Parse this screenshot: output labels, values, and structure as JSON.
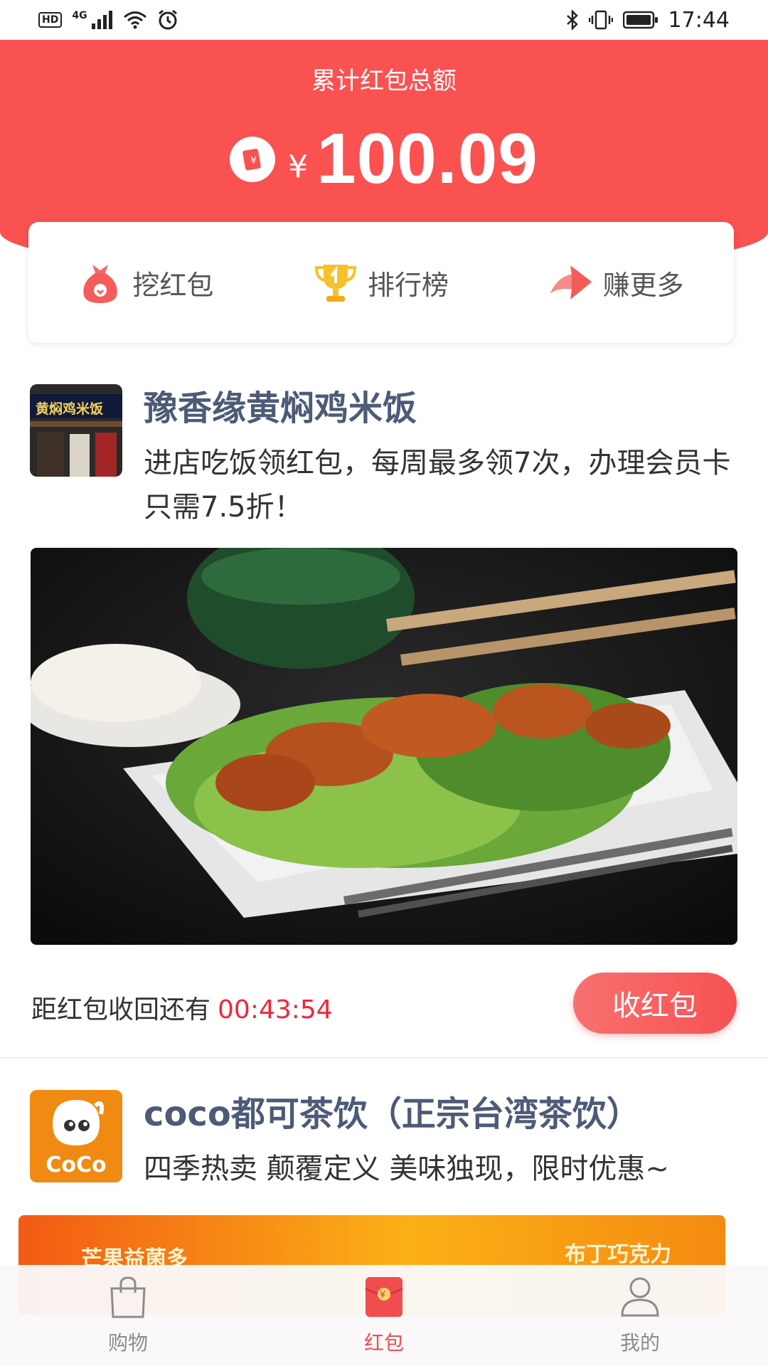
{
  "status_bar": {
    "time": "17:44",
    "network": "4G",
    "hd": "HD"
  },
  "header": {
    "label": "累计红包总额",
    "currency": "¥",
    "amount": "100.09"
  },
  "actions": [
    {
      "label": "挖红包",
      "icon": "money-bag-icon"
    },
    {
      "label": "排行榜",
      "icon": "trophy-icon"
    },
    {
      "label": "赚更多",
      "icon": "arrow-icon"
    }
  ],
  "merchants": [
    {
      "name": "豫香缘黄焖鸡米饭",
      "logo_text": "黄焖鸡米饭",
      "description": "进店吃饭领红包，每周最多领7次，办理会员卡只需7.5折！",
      "countdown_label": "距红包收回还有",
      "countdown_time": "00:43:54",
      "button": "收红包"
    },
    {
      "name": "coco都可茶饮（正宗台湾茶饮）",
      "logo_text": "CoCo",
      "description": "四季热卖 颠覆定义 美味独现，限时优惠~",
      "banner_left": "芒果益菌多",
      "banner_right": "布丁巧克力"
    }
  ],
  "tabs": [
    {
      "label": "购物",
      "icon": "shopping-bag-icon",
      "active": false
    },
    {
      "label": "红包",
      "icon": "red-envelope-icon",
      "active": true
    },
    {
      "label": "我的",
      "icon": "user-icon",
      "active": false
    }
  ],
  "colors": {
    "accent": "#fa5151",
    "name_color": "#4d5a78",
    "countdown": "#f0263b"
  }
}
